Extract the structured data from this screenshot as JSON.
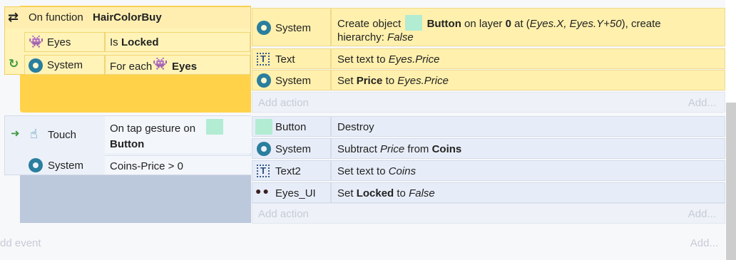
{
  "event1": {
    "title_prefix": "On function",
    "title_name": "HairColorBuy",
    "conditions": [
      {
        "object": "Eyes",
        "text_prefix": "Is",
        "text_bold": "Locked"
      },
      {
        "object": "System",
        "text_prefix": "For each",
        "text_bold": "Eyes"
      }
    ],
    "actions": [
      {
        "object": "System",
        "line1_a": "Create object",
        "line1_b": "Button",
        "line1_c": "on layer",
        "line1_d": "0",
        "line1_e": "at (",
        "line1_f": "Eyes.X, Eyes.Y+50",
        "line1_g": "), create",
        "line2_a": "hierarchy:",
        "line2_b": "False"
      },
      {
        "object": "Text",
        "text_a": "Set text to",
        "text_b": "Eyes.Price"
      },
      {
        "object": "System",
        "text_a": "Set",
        "text_b": "Price",
        "text_c": "to",
        "text_d": "Eyes.Price"
      }
    ],
    "add_action": "Add action",
    "add_more": "Add..."
  },
  "event2": {
    "conditions": [
      {
        "object": "Touch",
        "line1": "On tap gesture on",
        "line2": "Button"
      },
      {
        "object": "System",
        "text": "Coins-Price > 0"
      }
    ],
    "actions": [
      {
        "object": "Button",
        "text": "Destroy"
      },
      {
        "object": "System",
        "text_a": "Subtract",
        "text_b": "Price",
        "text_c": "from",
        "text_d": "Coins"
      },
      {
        "object": "Text2",
        "text_a": "Set text to",
        "text_b": "Coins"
      },
      {
        "object": "Eyes_UI",
        "text_a": "Set",
        "text_b": "Locked",
        "text_c": "to",
        "text_d": "False"
      }
    ],
    "add_action": "Add action",
    "add_more": "Add..."
  },
  "add_event": "dd event",
  "add_event_more": "Add...",
  "colors": {
    "function_accent": "#ffd24a",
    "event_block": "#bcc8dc",
    "gear": "#2a7e9e",
    "swatch": "#b2ecd3"
  }
}
